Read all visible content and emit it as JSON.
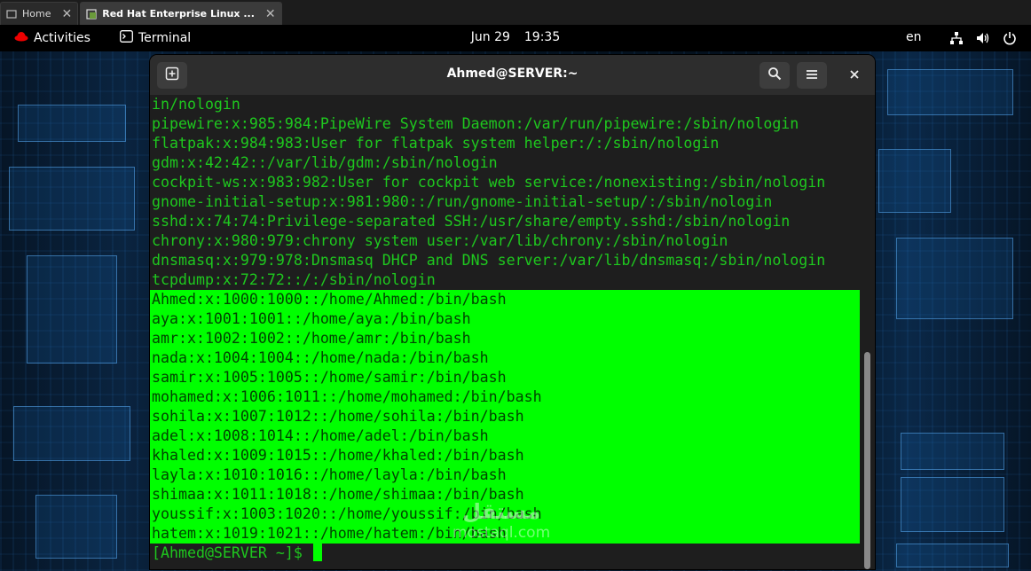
{
  "browser": {
    "tabs": [
      {
        "label": "Home",
        "active": false
      },
      {
        "label": "Red Hat Enterprise Linux ...",
        "active": true
      }
    ]
  },
  "topbar": {
    "activities": "Activities",
    "app_name": "Terminal",
    "date": "Jun 29",
    "time": "19:35",
    "language": "en"
  },
  "terminal": {
    "title": "Ahmed@SERVER:~",
    "lines": [
      "in/nologin",
      "pipewire:x:985:984:PipeWire System Daemon:/var/run/pipewire:/sbin/nologin",
      "flatpak:x:984:983:User for flatpak system helper:/:/sbin/nologin",
      "gdm:x:42:42::/var/lib/gdm:/sbin/nologin",
      "cockpit-ws:x:983:982:User for cockpit web service:/nonexisting:/sbin/nologin",
      "gnome-initial-setup:x:981:980::/run/gnome-initial-setup/:/sbin/nologin",
      "sshd:x:74:74:Privilege-separated SSH:/usr/share/empty.sshd:/sbin/nologin",
      "chrony:x:980:979:chrony system user:/var/lib/chrony:/sbin/nologin",
      "dnsmasq:x:979:978:Dnsmasq DHCP and DNS server:/var/lib/dnsmasq:/sbin/nologin",
      "tcpdump:x:72:72::/:/sbin/nologin"
    ],
    "highlighted_lines": [
      "Ahmed:x:1000:1000::/home/Ahmed:/bin/bash",
      "aya:x:1001:1001::/home/aya:/bin/bash",
      "amr:x:1002:1002::/home/amr:/bin/bash",
      "nada:x:1004:1004::/home/nada:/bin/bash",
      "samir:x:1005:1005::/home/samir:/bin/bash",
      "mohamed:x:1006:1011::/home/mohamed:/bin/bash",
      "sohila:x:1007:1012::/home/sohila:/bin/bash",
      "adel:x:1008:1014::/home/adel:/bin/bash",
      "khaled:x:1009:1015::/home/khaled:/bin/bash",
      "layla:x:1010:1016::/home/layla:/bin/bash",
      "shimaa:x:1011:1018::/home/shimaa:/bin/bash",
      "youssif:x:1003:1020::/home/youssif:/bin/bash",
      "hatem:x:1019:1021::/home/hatem:/bin/bash"
    ],
    "prompt": "[Ahmed@SERVER ~]$ "
  },
  "watermark": {
    "main": "مستقل",
    "sub": "mostaql.com"
  },
  "colors": {
    "terminal_text": "#1ec81e",
    "highlight": "#00ff00",
    "redhat": "#ee0000"
  }
}
